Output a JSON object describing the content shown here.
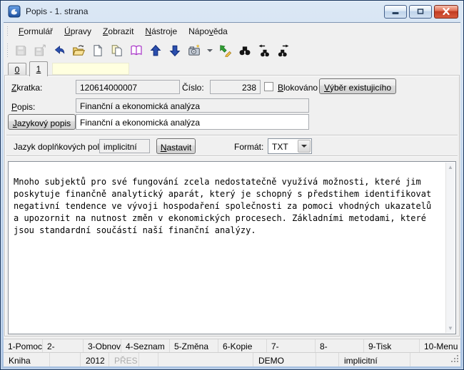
{
  "window": {
    "title": "Popis - 1. strana"
  },
  "controls": {
    "minimize": "minimize",
    "restore": "restore",
    "close": "close"
  },
  "menu": {
    "items": [
      {
        "label": "&Formulář"
      },
      {
        "label": "&Úpravy"
      },
      {
        "label": "&Zobrazit"
      },
      {
        "label": "&Nástroje"
      },
      {
        "label": "Nápo&věda"
      }
    ]
  },
  "toolbar": {
    "buttons": [
      {
        "name": "save-icon",
        "disabled": true
      },
      {
        "name": "save-as-icon",
        "disabled": true
      },
      {
        "name": "undo-icon",
        "disabled": false
      },
      {
        "name": "open-icon",
        "disabled": false
      },
      {
        "name": "new-icon",
        "disabled": false
      },
      {
        "name": "copy-icon",
        "disabled": false
      },
      {
        "name": "book-icon",
        "disabled": false
      },
      {
        "name": "move-up-icon",
        "disabled": false
      },
      {
        "name": "move-down-icon",
        "disabled": false
      },
      {
        "name": "snapshot-icon",
        "disabled": false
      },
      {
        "name": "edit-export-icon",
        "disabled": false
      },
      {
        "name": "find-icon",
        "disabled": false
      },
      {
        "name": "find-previous-icon",
        "disabled": false
      },
      {
        "name": "find-next-icon",
        "disabled": false
      }
    ]
  },
  "tabs": [
    {
      "label": "&0"
    },
    {
      "label": "&1",
      "active": true
    }
  ],
  "form": {
    "zkratka_label": "&Zkratka:",
    "zkratka_value": "120614000007",
    "cislo_label": "Číslo:",
    "cislo_value": "238",
    "blokovano_label": "&Blokováno",
    "vyber_button": "&Výběr existujicího",
    "popis_label": "&Popis:",
    "popis_value": "Finanční a ekonomická analýza",
    "jazykovy_button": "&Jazykový popis",
    "jazykovy_value": "Finanční a ekonomická analýza",
    "jazyk_label": "Jazyk doplňkových polí:",
    "jazyk_value": "implicitní",
    "nastavit_button": "&Nastavit",
    "format_label": "Formát:",
    "format_value": "TXT"
  },
  "editor": {
    "text": "\nMnoho subjektů pro své fungování zcela nedostatečně využívá možnosti, které jim\nposkytuje finančně analytický aparát, který je schopný s předstihem identifikovat\nnegativní tendence ve vývoji hospodaření společnosti za pomoci vhodných ukazatelů\na upozornit na nutnost změn v ekonomických procesech. Základními metodami, které\njsou standardní součástí naší finanční analýzy.",
    "scroll_up_icon": "▲",
    "scroll_down_icon": "▼"
  },
  "fkeys": [
    "1-Pomoc",
    "2-",
    "3-Obnov",
    "4-Seznam",
    "5-Změna",
    "6-Kopie",
    "7-",
    "8-",
    "9-Tisk",
    "10-Menu"
  ],
  "statusbar": {
    "cells": [
      {
        "text": "Kniha"
      },
      {
        "text": ""
      },
      {
        "text": "2012"
      },
      {
        "text": "PŘES",
        "muted": true
      },
      {
        "text": ""
      },
      {
        "text": ""
      },
      {
        "text": "DEMO"
      },
      {
        "text": ""
      },
      {
        "text": "implicitní"
      },
      {
        "text": ""
      }
    ]
  },
  "colors": {
    "titlebar_top": "#dce8f5",
    "titlebar_bottom": "#aac3e2",
    "frame_border": "#17355f",
    "close_button": "#c03a20",
    "panel_bg": "#f0f0f0",
    "note_yellow": "#ffffdf",
    "muted_text": "#adadad"
  }
}
